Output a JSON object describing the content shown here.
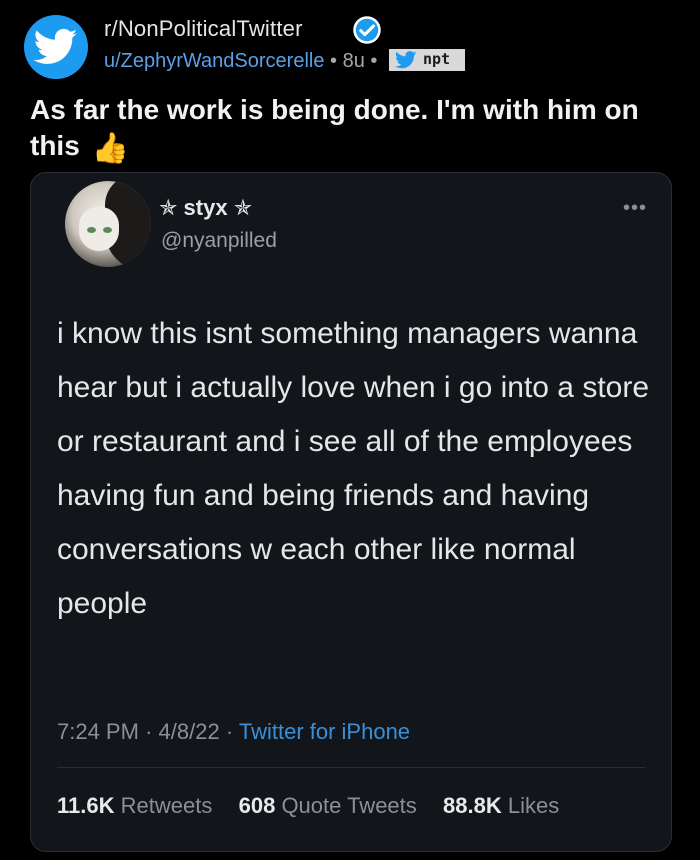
{
  "post": {
    "subreddit": "r/NonPoliticalTwitter",
    "author": "u/ZephyrWandSorcerelle",
    "separator": "•",
    "age": "8u",
    "flair_text": "npt",
    "title": "As far the work is being done. I'm with him on this",
    "title_emoji": "👍"
  },
  "tweet": {
    "display_name": "✯ styx ✯",
    "handle": "@nyanpilled",
    "more_label": "•••",
    "body": "i know this isnt something managers wanna hear but i actually love when i go into a store or restaurant and i see all of the employees having fun and being friends and having conversations w each other like normal people",
    "time": "7:24 PM",
    "date": "4/8/22",
    "meta_sep": "·",
    "source": "Twitter for iPhone",
    "stats": {
      "retweets_count": "11.6K",
      "retweets_label": "Retweets",
      "quotes_count": "608",
      "quotes_label": "Quote Tweets",
      "likes_count": "88.8K",
      "likes_label": "Likes"
    }
  },
  "colors": {
    "background": "#000000",
    "card": "#12151a",
    "link_blue": "#3a90d8",
    "subreddit_icon": "#1d9bf0"
  },
  "icons": [
    "twitter-bird-icon",
    "verified-badge-icon",
    "more-options-icon"
  ]
}
